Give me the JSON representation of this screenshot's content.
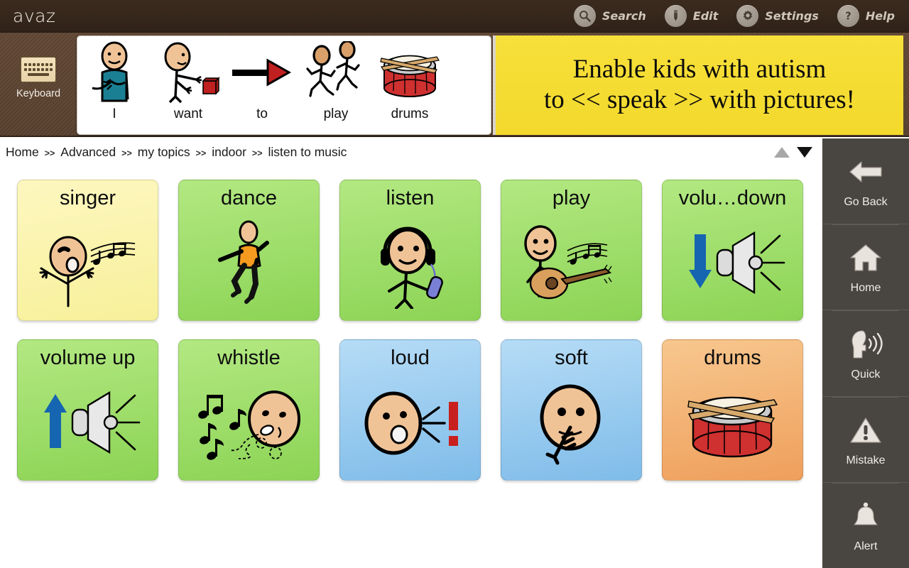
{
  "app": {
    "brand": "avaz"
  },
  "toolbar": {
    "items": [
      {
        "label": "Search",
        "icon": "search-icon"
      },
      {
        "label": "Edit",
        "icon": "pencil-icon"
      },
      {
        "label": "Settings",
        "icon": "gear-icon"
      },
      {
        "label": "Help",
        "icon": "question-mark-icon"
      }
    ]
  },
  "keyboard_button": {
    "label": "Keyboard",
    "icon": "keyboard-icon"
  },
  "sentence_bar": {
    "words": [
      {
        "label": "I",
        "icon": "person-self-pictogram"
      },
      {
        "label": "want",
        "icon": "person-reaching-for-block-pictogram"
      },
      {
        "label": "to",
        "icon": "arrow-right-pictogram"
      },
      {
        "label": "play",
        "icon": "two-children-running-pictogram"
      },
      {
        "label": "drums",
        "icon": "snare-drum-pictogram"
      }
    ]
  },
  "promo": {
    "line1": "Enable kids with autism",
    "line2": "to << speak >> with pictures!"
  },
  "breadcrumb": {
    "separator": ">>",
    "items": [
      "Home",
      "Advanced",
      "my topics",
      "indoor",
      "listen to music"
    ]
  },
  "scroll": {
    "up": "scroll-up-arrow",
    "down": "scroll-down-arrow"
  },
  "grid": {
    "rows": [
      [
        {
          "label": "singer",
          "color": "yellow",
          "icon": "singing-person-with-notes-pictogram"
        },
        {
          "label": "dance",
          "color": "green",
          "icon": "dancing-person-pictogram"
        },
        {
          "label": "listen",
          "color": "green",
          "icon": "person-with-headphones-pictogram"
        },
        {
          "label": "play",
          "color": "green",
          "icon": "person-with-guitar-pictogram"
        },
        {
          "label": "volu…down",
          "color": "green",
          "icon": "volume-down-speaker-pictogram"
        }
      ],
      [
        {
          "label": "volume up",
          "color": "green",
          "icon": "volume-up-speaker-pictogram"
        },
        {
          "label": "whistle",
          "color": "green",
          "icon": "whistling-face-with-notes-pictogram"
        },
        {
          "label": "loud",
          "color": "blue",
          "icon": "shouting-face-with-exclamation-pictogram"
        },
        {
          "label": "soft",
          "color": "blue",
          "icon": "quiet-face-finger-to-lips-pictogram"
        },
        {
          "label": "drums",
          "color": "orange",
          "icon": "snare-drum-pictogram"
        }
      ]
    ]
  },
  "sidebar": {
    "items": [
      {
        "label": "Go Back",
        "icon": "back-arrow-icon"
      },
      {
        "label": "Home",
        "icon": "house-icon"
      },
      {
        "label": "Quick",
        "icon": "speaking-head-icon"
      },
      {
        "label": "Mistake",
        "icon": "warning-triangle-icon"
      },
      {
        "label": "Alert",
        "icon": "bell-icon"
      }
    ]
  },
  "colors": {
    "topbar": "#36271c",
    "strip": "#58402e",
    "promo": "#f4da2e",
    "sidebar": "#494540",
    "noun_yellow": "#f7f09a",
    "verb_green": "#8cd455",
    "descriptor_blue": "#7fbce9",
    "object_orange": "#ef9f5c"
  }
}
